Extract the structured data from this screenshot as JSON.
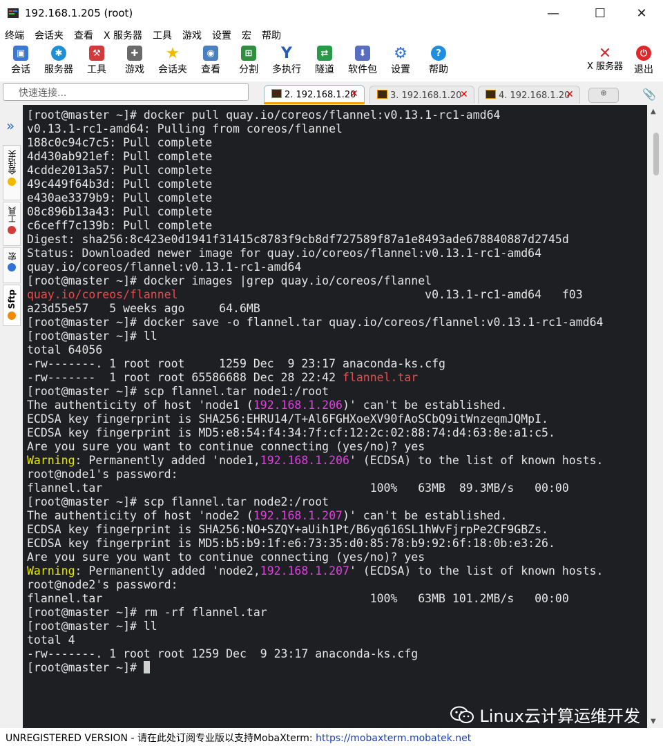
{
  "window": {
    "title": "192.168.1.205 (root)",
    "minimize": "—",
    "maximize": "☐",
    "close": "✕"
  },
  "menu": [
    "终端",
    "会话夹",
    "查看",
    "X 服务器",
    "工具",
    "游戏",
    "设置",
    "宏",
    "帮助"
  ],
  "toolbar": {
    "items": [
      {
        "label": "会话",
        "icon": "session-icon",
        "color": "#3a78d6"
      },
      {
        "label": "服务器",
        "icon": "servers-icon",
        "color": "#1f8fd6"
      },
      {
        "label": "工具",
        "icon": "tools-icon",
        "color": "#d23b3b"
      },
      {
        "label": "游戏",
        "icon": "games-icon",
        "color": "#6a6a6a"
      },
      {
        "label": "会话夹",
        "icon": "star-icon",
        "color": "#f2b800"
      },
      {
        "label": "查看",
        "icon": "view-icon",
        "color": "#4a7fc0"
      },
      {
        "label": "分割",
        "icon": "split-icon",
        "color": "#2f8f3f"
      },
      {
        "label": "多执行",
        "icon": "multiexec-icon",
        "color": "#2a5ab8"
      },
      {
        "label": "隧道",
        "icon": "tunnel-icon",
        "color": "#2a9a4a"
      },
      {
        "label": "软件包",
        "icon": "packages-icon",
        "color": "#5a6ec0"
      },
      {
        "label": "设置",
        "icon": "gear-icon",
        "color": "#2f72d8"
      },
      {
        "label": "帮助",
        "icon": "help-icon",
        "color": "#1e8ee0"
      }
    ],
    "xserver": "X 服务器",
    "exit": "退出"
  },
  "quick_connect": {
    "placeholder": "快速连接..."
  },
  "tabs": [
    {
      "label": "2. 192.168.1.20",
      "close": "✕"
    },
    {
      "label": "3. 192.168.1.20",
      "close": "✕"
    },
    {
      "label": "4. 192.168.1.20",
      "close": "✕"
    }
  ],
  "sidebar": {
    "sessions": "会话夹",
    "tools": "工具",
    "macros": "宏",
    "sftp": "Sftp"
  },
  "terminal": {
    "lines": [
      [
        {
          "t": "[root@master ~]# docker pull quay.io/coreos/flannel:v0.13.1-rc1-amd64"
        }
      ],
      [
        {
          "t": "v0.13.1-rc1-amd64: Pulling from coreos/flannel"
        }
      ],
      [
        {
          "t": "188c0c94c7c5: Pull complete"
        }
      ],
      [
        {
          "t": "4d430ab921ef: Pull complete"
        }
      ],
      [
        {
          "t": "4cdde2013a57: Pull complete"
        }
      ],
      [
        {
          "t": "49c449f64b3d: Pull complete"
        }
      ],
      [
        {
          "t": "e430ae3379b9: Pull complete"
        }
      ],
      [
        {
          "t": "08c896b13a43: Pull complete"
        }
      ],
      [
        {
          "t": "c6ceff7c139b: Pull complete"
        }
      ],
      [
        {
          "t": "Digest: sha256:8c423e0d1941f31415c8783f9cb8df727589f87a1e8493ade678840887d2745d"
        }
      ],
      [
        {
          "t": "Status: Downloaded newer image for quay.io/coreos/flannel:v0.13.1-rc1-amd64"
        }
      ],
      [
        {
          "t": "quay.io/coreos/flannel:v0.13.1-rc1-amd64"
        }
      ],
      [
        {
          "t": "[root@master ~]# docker images |grep quay.io/coreos/flannel"
        }
      ],
      [
        {
          "t": "quay.io/coreos/flannel",
          "c": "c-red"
        },
        {
          "t": "                                    v0.13.1-rc1-amd64   f03"
        }
      ],
      [
        {
          "t": "a23d55e57   5 weeks ago     64.6MB"
        }
      ],
      [
        {
          "t": "[root@master ~]# docker save -o flannel.tar quay.io/coreos/flannel:v0.13.1-rc1-amd64"
        }
      ],
      [
        {
          "t": "[root@master ~]# ll"
        }
      ],
      [
        {
          "t": "total 64056"
        }
      ],
      [
        {
          "t": "-rw-------. 1 root root     1259 Dec  9 23:17 anaconda-ks.cfg"
        }
      ],
      [
        {
          "t": "-rw-------  1 root root 65586688 Dec 28 22:42 "
        },
        {
          "t": "flannel.tar",
          "c": "c-red"
        }
      ],
      [
        {
          "t": "[root@master ~]# scp flannel.tar node1:/root"
        }
      ],
      [
        {
          "t": "The authenticity of host 'node1 ("
        },
        {
          "t": "192.168.1.206",
          "c": "c-mag"
        },
        {
          "t": ")' can't be established."
        }
      ],
      [
        {
          "t": "ECDSA key fingerprint is SHA256:EHRU14/T+Al6FGHXoeXV90fAoSCbQ9itWnzeqmJQMpI."
        }
      ],
      [
        {
          "t": "ECDSA key fingerprint is MD5:e8:54:f4:34:7f:cf:12:2c:02:88:74:d4:63:8e:a1:c5."
        }
      ],
      [
        {
          "t": "Are you sure you want to continue connecting (yes/no)? yes"
        }
      ],
      [
        {
          "t": "Warning",
          "c": "c-yel"
        },
        {
          "t": ": Permanently added 'node1,"
        },
        {
          "t": "192.168.1.206",
          "c": "c-mag"
        },
        {
          "t": "' (ECDSA) to the list of known hosts."
        }
      ],
      [
        {
          "t": "root@node1's password:"
        }
      ],
      [
        {
          "t": "flannel.tar                                       100%   63MB  89.3MB/s   00:00"
        }
      ],
      [
        {
          "t": "[root@master ~]# scp flannel.tar node2:/root"
        }
      ],
      [
        {
          "t": "The authenticity of host 'node2 ("
        },
        {
          "t": "192.168.1.207",
          "c": "c-mag"
        },
        {
          "t": ")' can't be established."
        }
      ],
      [
        {
          "t": "ECDSA key fingerprint is SHA256:NO+SZQY+aUih1Pt/B6yq616SL1hWvFjrpPe2CF9GBZs."
        }
      ],
      [
        {
          "t": "ECDSA key fingerprint is MD5:b5:b9:1f:e6:73:35:d0:85:78:b9:92:6f:18:0b:e3:26."
        }
      ],
      [
        {
          "t": "Are you sure you want to continue connecting (yes/no)? yes"
        }
      ],
      [
        {
          "t": "Warning",
          "c": "c-yel"
        },
        {
          "t": ": Permanently added 'node2,"
        },
        {
          "t": "192.168.1.207",
          "c": "c-mag"
        },
        {
          "t": "' (ECDSA) to the list of known hosts."
        }
      ],
      [
        {
          "t": "root@node2's password:"
        }
      ],
      [
        {
          "t": "flannel.tar                                       100%   63MB 101.2MB/s   00:00"
        }
      ],
      [
        {
          "t": "[root@master ~]# rm -rf flannel.tar"
        }
      ],
      [
        {
          "t": "[root@master ~]# ll"
        }
      ],
      [
        {
          "t": "total 4"
        }
      ],
      [
        {
          "t": "-rw-------. 1 root root 1259 Dec  9 23:17 anaconda-ks.cfg"
        }
      ],
      [
        {
          "t": "[root@master ~]# "
        }
      ]
    ]
  },
  "watermark": "Linux云计算运维开发",
  "status": {
    "unregistered": "UNREGISTERED VERSION",
    "message": "  -  请在此处订阅专业版以支持MobaXterm:  ",
    "link": "https://mobaxterm.mobatek.net"
  }
}
